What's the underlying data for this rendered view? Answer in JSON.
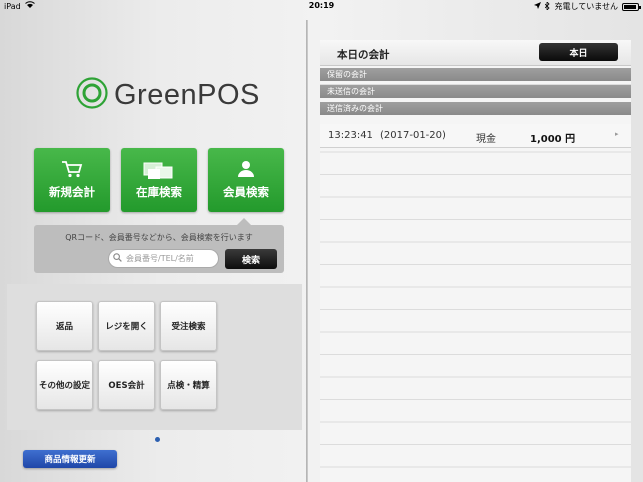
{
  "status_bar": {
    "device": "iPad",
    "time": "20:19",
    "charging_text": "充電していません"
  },
  "logo": {
    "text": "GreenPOS"
  },
  "main_buttons": [
    {
      "label": "新規会計",
      "icon": "cart-icon"
    },
    {
      "label": "在庫検索",
      "icon": "boxes-icon"
    },
    {
      "label": "会員検索",
      "icon": "person-icon"
    }
  ],
  "member_search": {
    "hint": "QRコード、会員番号などから、会員検索を行います",
    "placeholder": "会員番号/TEL/名前",
    "button_label": "検索"
  },
  "menu_buttons": [
    {
      "label": "返品"
    },
    {
      "label": "レジを開く"
    },
    {
      "label": "受注検索"
    },
    {
      "label": "その他の設定"
    },
    {
      "label": "OES会計"
    },
    {
      "label": "点検・精算"
    }
  ],
  "update_button_label": "商品情報更新",
  "today_panel": {
    "title": "本日の会計",
    "today_button_label": "本日",
    "sections": {
      "held": "保留の会計",
      "unsent": "未送信の会計",
      "sent": "送信済みの会計"
    },
    "transactions": [
      {
        "time": "13:23:41",
        "date": "(2017-01-20)",
        "payment": "現金",
        "amount": "1,000 円"
      }
    ]
  },
  "colors": {
    "accent_green": "#2ea336",
    "update_blue": "#2a56b8",
    "section_gray": "#949494"
  }
}
